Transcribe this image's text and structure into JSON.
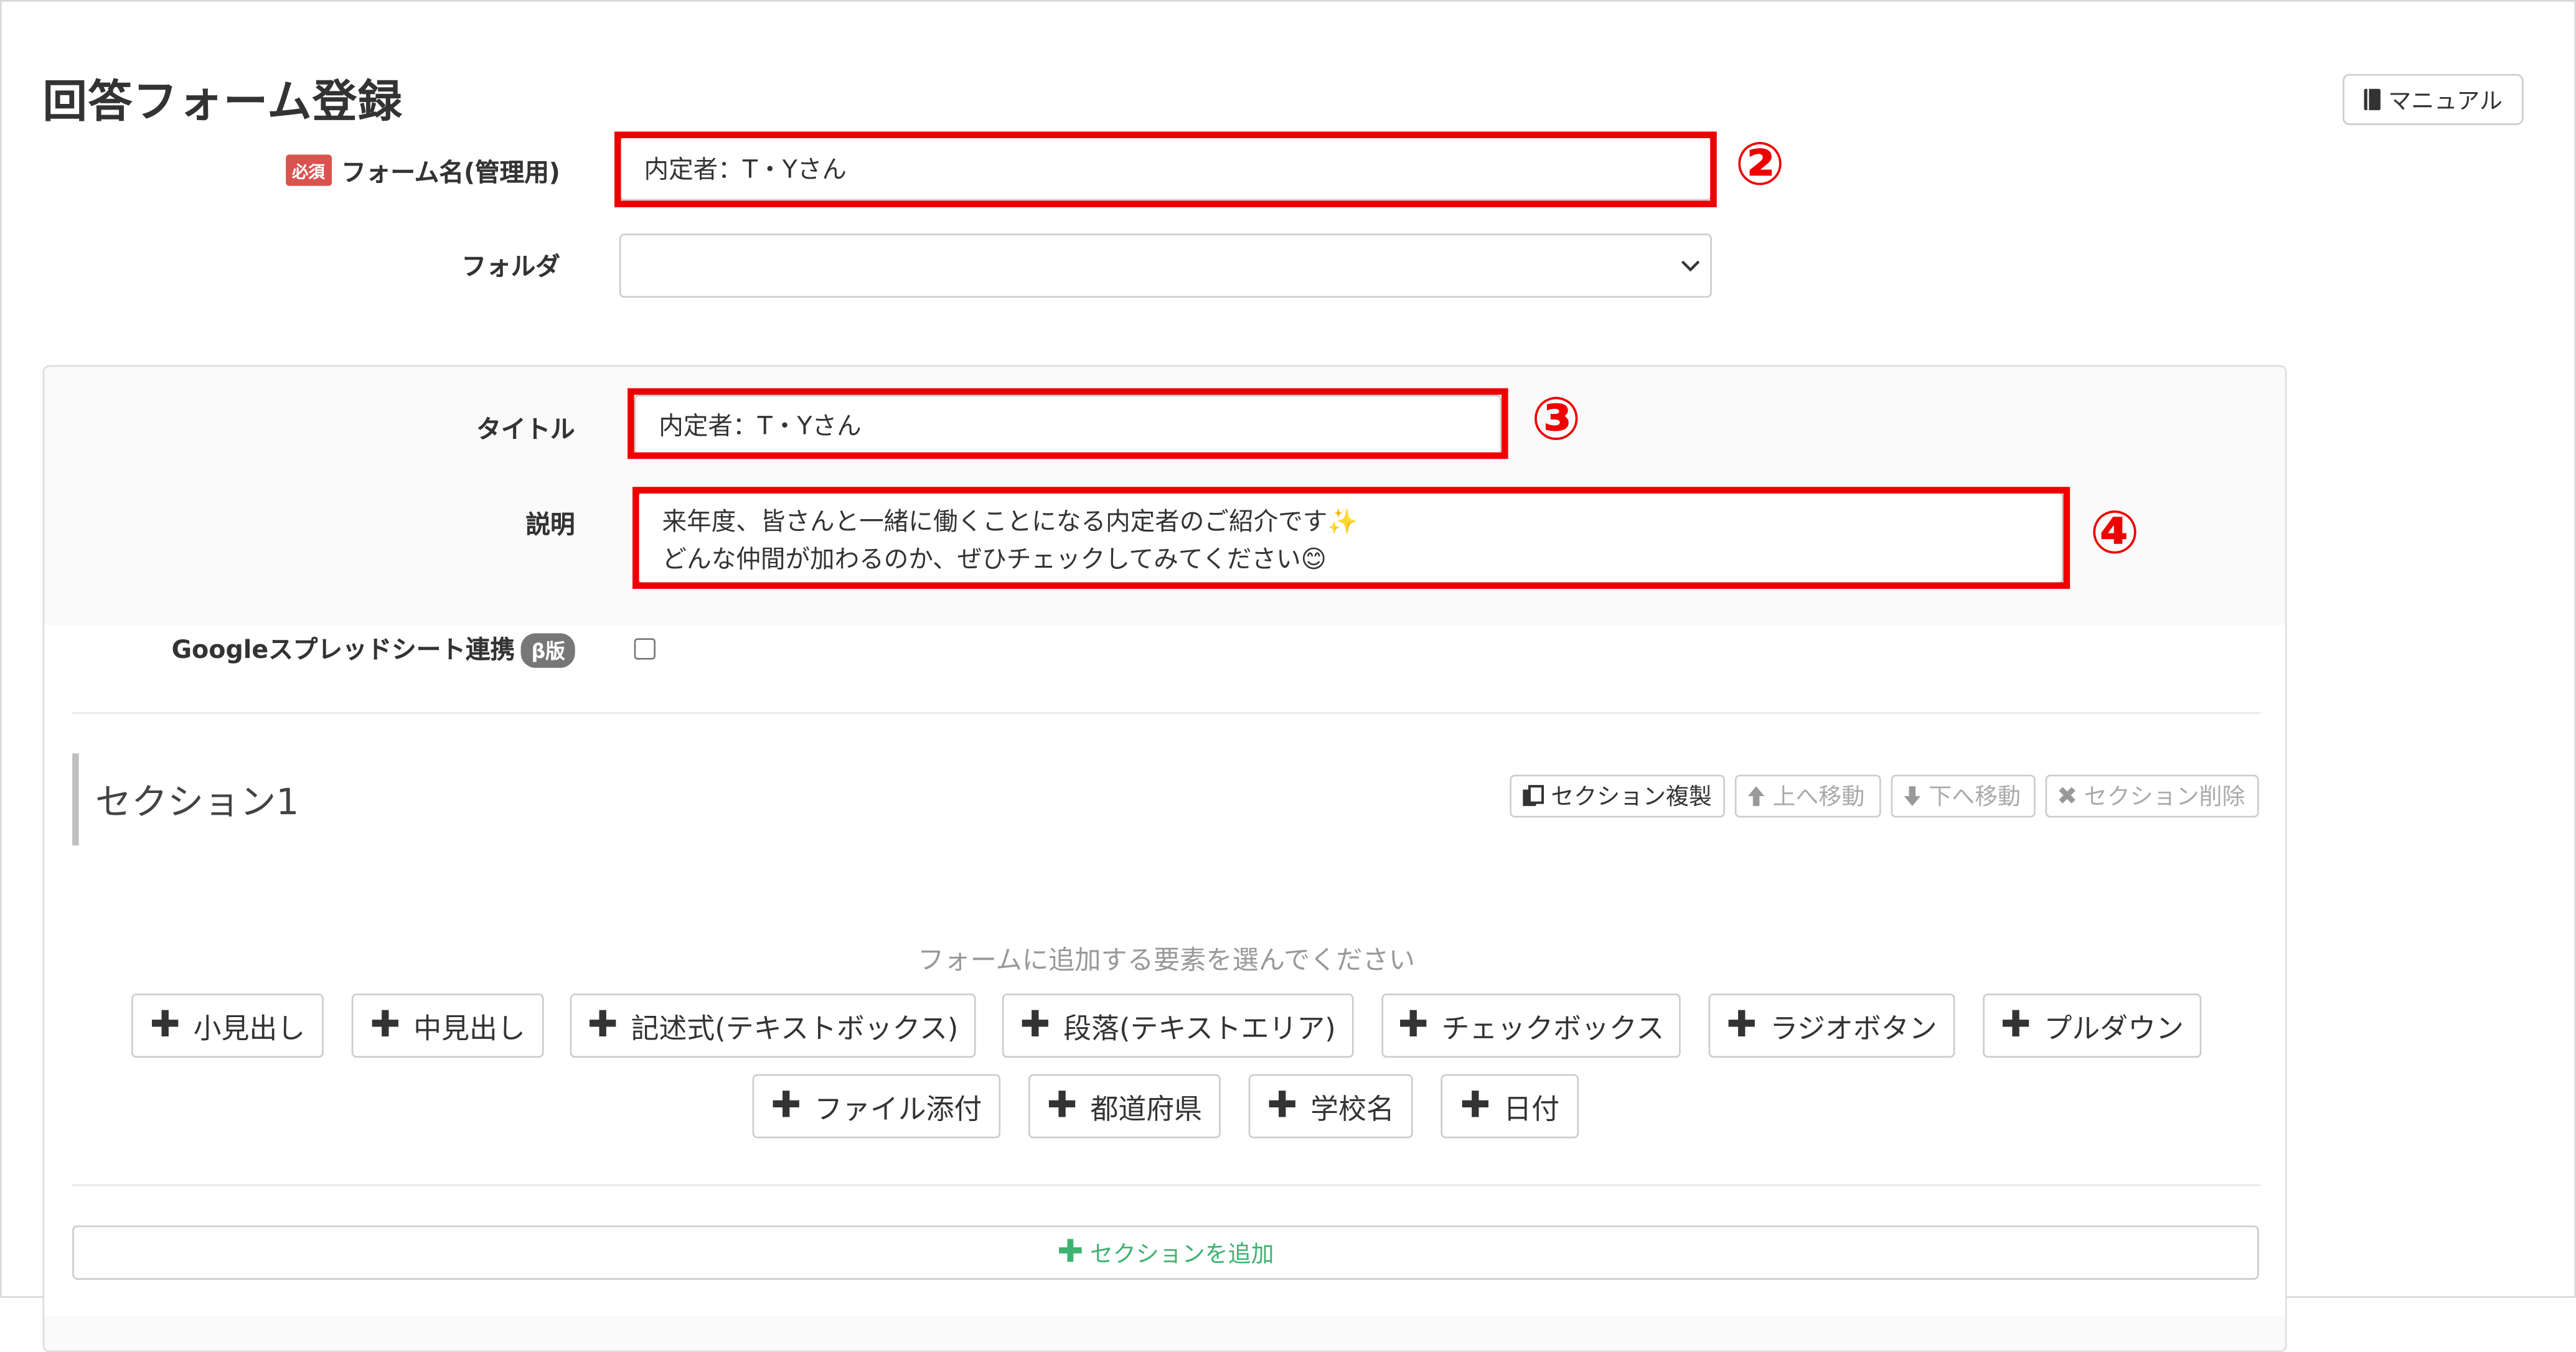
{
  "page": {
    "title": "回答フォーム登録",
    "manual_label": "マニュアル",
    "required_badge": "必須",
    "beta_badge": "β版"
  },
  "form": {
    "name_label": "フォーム名(管理用)",
    "name_value": "内定者：T・Yさん",
    "folder_label": "フォルダ",
    "folder_value": "",
    "title_label": "タイトル",
    "title_value": "内定者：T・Yさん",
    "description_label": "説明",
    "description_line1": "来年度、皆さんと一緒に働くことになる内定者のご紹介です✨",
    "description_line2": "どんな仲間が加わるのか、ぜひチェックしてみてください😊",
    "sheets_label": "Googleスプレッドシート連携",
    "sheets_checked": false
  },
  "annotations": [
    "②",
    "③",
    "④"
  ],
  "section": {
    "title": "セクション1",
    "buttons": {
      "copy": "セクション複製",
      "up": "上へ移動",
      "down": "下へ移動",
      "delete": "セクション削除"
    },
    "hint": "フォームに追加する要素を選んでください",
    "elements_row1": [
      "小見出し",
      "中見出し",
      "記述式(テキストボックス)",
      "段落(テキストエリア)",
      "チェックボックス",
      "ラジオボタン",
      "プルダウン"
    ],
    "elements_row2": [
      "ファイル添付",
      "都道府県",
      "学校名",
      "日付"
    ],
    "add_section": "セクションを追加"
  },
  "colors": {
    "annotation_red": "#ee0000",
    "required_badge": "#d9534f",
    "add_section_green": "#3cb371"
  }
}
